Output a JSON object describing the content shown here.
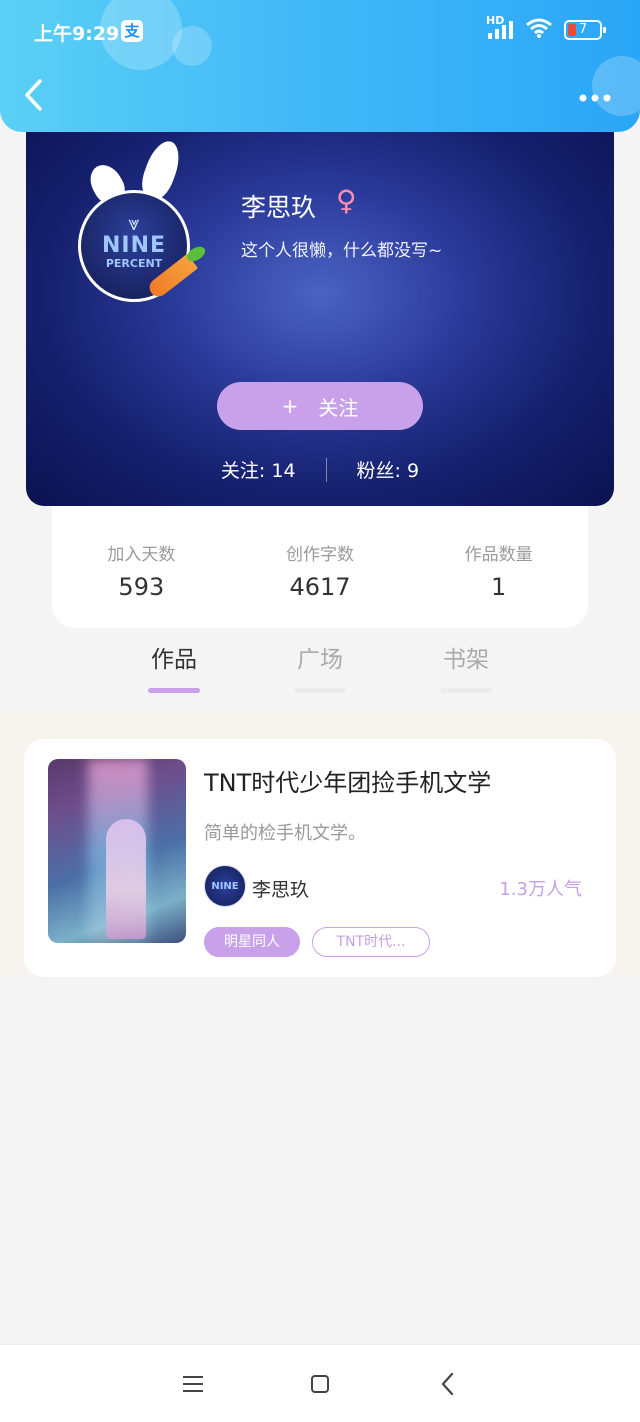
{
  "status_bar": {
    "time": "上午9:29",
    "alipay_icon_label": "支",
    "network_label": "HD",
    "battery_level": "7"
  },
  "header": {
    "back_icon": "chevron-left-icon",
    "more_icon": "more-dots-icon"
  },
  "profile": {
    "avatar_logo_text_top": "NINE",
    "avatar_logo_text_bottom": "PERCENT",
    "name": "李思玖",
    "gender_symbol": "♀",
    "bio": "这个人很懒，什么都没写~",
    "follow_button": {
      "icon": "+",
      "label": "关注"
    },
    "following_label": "关注: 14",
    "followers_label": "粉丝: 9"
  },
  "stats": [
    {
      "label": "加入天数",
      "value": "593"
    },
    {
      "label": "创作字数",
      "value": "4617"
    },
    {
      "label": "作品数量",
      "value": "1"
    }
  ],
  "tabs": [
    {
      "label": "作品",
      "active": true
    },
    {
      "label": "广场",
      "active": false
    },
    {
      "label": "书架",
      "active": false
    }
  ],
  "works": [
    {
      "title": "TNT时代少年团捡手机文学",
      "description": "简单的检手机文学。",
      "author": "李思玖",
      "popularity": "1.3万人气",
      "tags": [
        "明星同人",
        "TNT时代..."
      ]
    }
  ],
  "bottom_nav": {
    "menu_icon": "menu-icon",
    "home_icon": "home-square-icon",
    "back_icon": "back-triangle-icon"
  },
  "colors": {
    "header_gradient_start": "#5ad0f6",
    "header_gradient_end": "#2aa6f7",
    "accent_purple": "#c9a1ea",
    "profile_bg_dark": "#0b1250"
  }
}
